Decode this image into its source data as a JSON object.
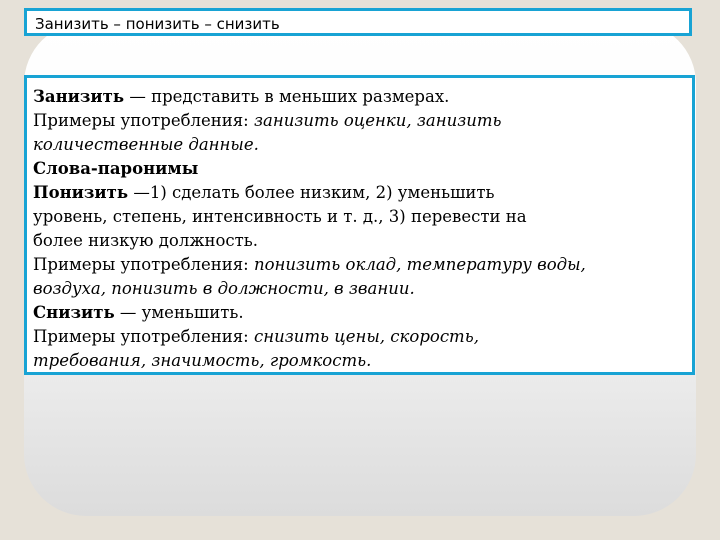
{
  "title": "Занизить – понизить – снизить",
  "entries": {
    "zanizit_word": "Занизить",
    "zanizit_def": " — представить в меньших размерах.",
    "zanizit_examples_label": "Примеры употребления: ",
    "zanizit_examples_1": "занизить оценки, занизить",
    "zanizit_examples_2": "количественные данные.",
    "paronyms_heading": "Слова-паронимы",
    "ponizit_word": "Понизить",
    "ponizit_def_1": " —1) сделать более низким, 2) уменьшить",
    "ponizit_def_2": "уровень, степень, интенсивность и т. д., 3) перевести на",
    "ponizit_def_3": "более низкую должность.",
    "ponizit_examples_label": "Примеры употребления: ",
    "ponizit_examples_1": "понизить оклад, температуру воды,",
    "ponizit_examples_2": "воздуха, понизить в должности, в звании.",
    "snizit_word": "Снизить",
    "snizit_def": " — уменьшить.",
    "snizit_examples_label": "Примеры употребления: ",
    "snizit_examples_1": "снизить цены, скорость,",
    "snizit_examples_2": "требования, значимость, громкость."
  },
  "colors": {
    "border": "#18a3d4",
    "background": "#e6e1d8"
  }
}
